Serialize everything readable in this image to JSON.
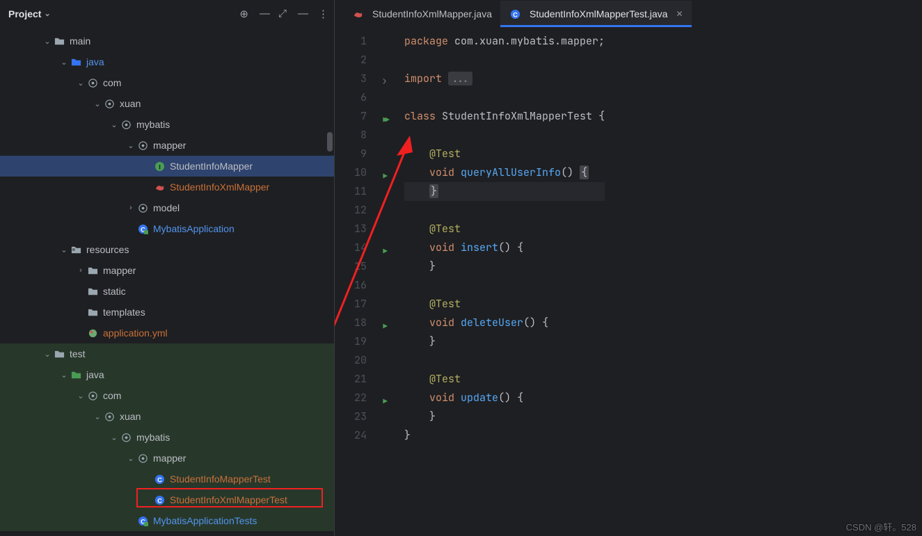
{
  "sidebar": {
    "title": "Project",
    "header_icons": [
      "target",
      "collapse",
      "expand",
      "hide",
      "more"
    ],
    "tree": [
      {
        "depth": 3,
        "arrow": "expanded",
        "icon": "folder",
        "label": "main",
        "cls": ""
      },
      {
        "depth": 4,
        "arrow": "expanded",
        "icon": "folder-src",
        "label": "java",
        "cls": "blue"
      },
      {
        "depth": 5,
        "arrow": "expanded",
        "icon": "package",
        "label": "com",
        "cls": ""
      },
      {
        "depth": 6,
        "arrow": "expanded",
        "icon": "package",
        "label": "xuan",
        "cls": ""
      },
      {
        "depth": 7,
        "arrow": "expanded",
        "icon": "package",
        "label": "mybatis",
        "cls": ""
      },
      {
        "depth": 8,
        "arrow": "expanded",
        "icon": "package",
        "label": "mapper",
        "cls": ""
      },
      {
        "depth": 9,
        "arrow": "none",
        "icon": "interface",
        "label": "StudentInfoMapper",
        "cls": "",
        "selected": true
      },
      {
        "depth": 9,
        "arrow": "none",
        "icon": "mybatis",
        "label": "StudentInfoXmlMapper",
        "cls": "orange"
      },
      {
        "depth": 8,
        "arrow": "collapsed",
        "icon": "package",
        "label": "model",
        "cls": ""
      },
      {
        "depth": 8,
        "arrow": "none",
        "icon": "spring-class",
        "label": "MybatisApplication",
        "cls": "blue"
      },
      {
        "depth": 4,
        "arrow": "expanded",
        "icon": "folder-res",
        "label": "resources",
        "cls": ""
      },
      {
        "depth": 5,
        "arrow": "collapsed",
        "icon": "folder",
        "label": "mapper",
        "cls": ""
      },
      {
        "depth": 5,
        "arrow": "none",
        "icon": "folder",
        "label": "static",
        "cls": ""
      },
      {
        "depth": 5,
        "arrow": "none",
        "icon": "folder",
        "label": "templates",
        "cls": ""
      },
      {
        "depth": 5,
        "arrow": "none",
        "icon": "yml",
        "label": "application.yml",
        "cls": "orange"
      },
      {
        "depth": 3,
        "arrow": "expanded",
        "icon": "folder",
        "label": "test",
        "cls": "",
        "test": true
      },
      {
        "depth": 4,
        "arrow": "expanded",
        "icon": "folder-test",
        "label": "java",
        "cls": "",
        "test": true
      },
      {
        "depth": 5,
        "arrow": "expanded",
        "icon": "package",
        "label": "com",
        "cls": "",
        "test": true
      },
      {
        "depth": 6,
        "arrow": "expanded",
        "icon": "package",
        "label": "xuan",
        "cls": "",
        "test": true
      },
      {
        "depth": 7,
        "arrow": "expanded",
        "icon": "package",
        "label": "mybatis",
        "cls": "",
        "test": true
      },
      {
        "depth": 8,
        "arrow": "expanded",
        "icon": "package",
        "label": "mapper",
        "cls": "",
        "test": true
      },
      {
        "depth": 9,
        "arrow": "none",
        "icon": "class",
        "label": "StudentInfoMapperTest",
        "cls": "orange",
        "test": true
      },
      {
        "depth": 9,
        "arrow": "none",
        "icon": "class",
        "label": "StudentInfoXmlMapperTest",
        "cls": "orange",
        "test": true,
        "boxed": true
      },
      {
        "depth": 8,
        "arrow": "none",
        "icon": "spring-class",
        "label": "MybatisApplicationTests",
        "cls": "blue",
        "test": true
      }
    ]
  },
  "tabs": [
    {
      "icon": "mybatis",
      "label": "StudentInfoXmlMapper.java",
      "active": false
    },
    {
      "icon": "class",
      "label": "StudentInfoXmlMapperTest.java",
      "active": true
    }
  ],
  "code": {
    "lines": [
      {
        "n": 1,
        "html": "<span class='kwd'>package</span> <span class='pkg'>com.xuan.mybatis.mapper;</span>"
      },
      {
        "n": 2,
        "html": ""
      },
      {
        "n": 3,
        "html": "<span class='kwd'>import</span> <span class='fold'>...</span>",
        "foldmark": true
      },
      {
        "n": 6,
        "html": ""
      },
      {
        "n": 7,
        "html": "<span class='kwd'>class</span> <span class='pkg'>StudentInfoXmlMapperTest</span> <span class='br'>{</span>",
        "run": "double"
      },
      {
        "n": 8,
        "html": ""
      },
      {
        "n": 9,
        "html": "    <span class='ann'>@Test</span>"
      },
      {
        "n": 10,
        "html": "    <span class='kwd'>void</span> <span class='fn'>queryAllUserInfo</span>() <span class='hl-brace'>{</span>",
        "run": "single"
      },
      {
        "n": 11,
        "html": "    <span class='hl-brace'>}</span>",
        "caret": true
      },
      {
        "n": 12,
        "html": ""
      },
      {
        "n": 13,
        "html": "    <span class='ann'>@Test</span>"
      },
      {
        "n": 14,
        "html": "    <span class='kwd'>void</span> <span class='fn'>insert</span>() {",
        "run": "single"
      },
      {
        "n": 15,
        "html": "    }"
      },
      {
        "n": 16,
        "html": ""
      },
      {
        "n": 17,
        "html": "    <span class='ann'>@Test</span>"
      },
      {
        "n": 18,
        "html": "    <span class='kwd'>void</span> <span class='fn'>deleteUser</span>() {",
        "run": "single"
      },
      {
        "n": 19,
        "html": "    }"
      },
      {
        "n": 20,
        "html": ""
      },
      {
        "n": 21,
        "html": "    <span class='ann'>@Test</span>"
      },
      {
        "n": 22,
        "html": "    <span class='kwd'>void</span> <span class='fn'>update</span>() {",
        "run": "single"
      },
      {
        "n": 23,
        "html": "    }"
      },
      {
        "n": 24,
        "html": "}"
      }
    ]
  },
  "watermark": "CSDN @轩。528"
}
